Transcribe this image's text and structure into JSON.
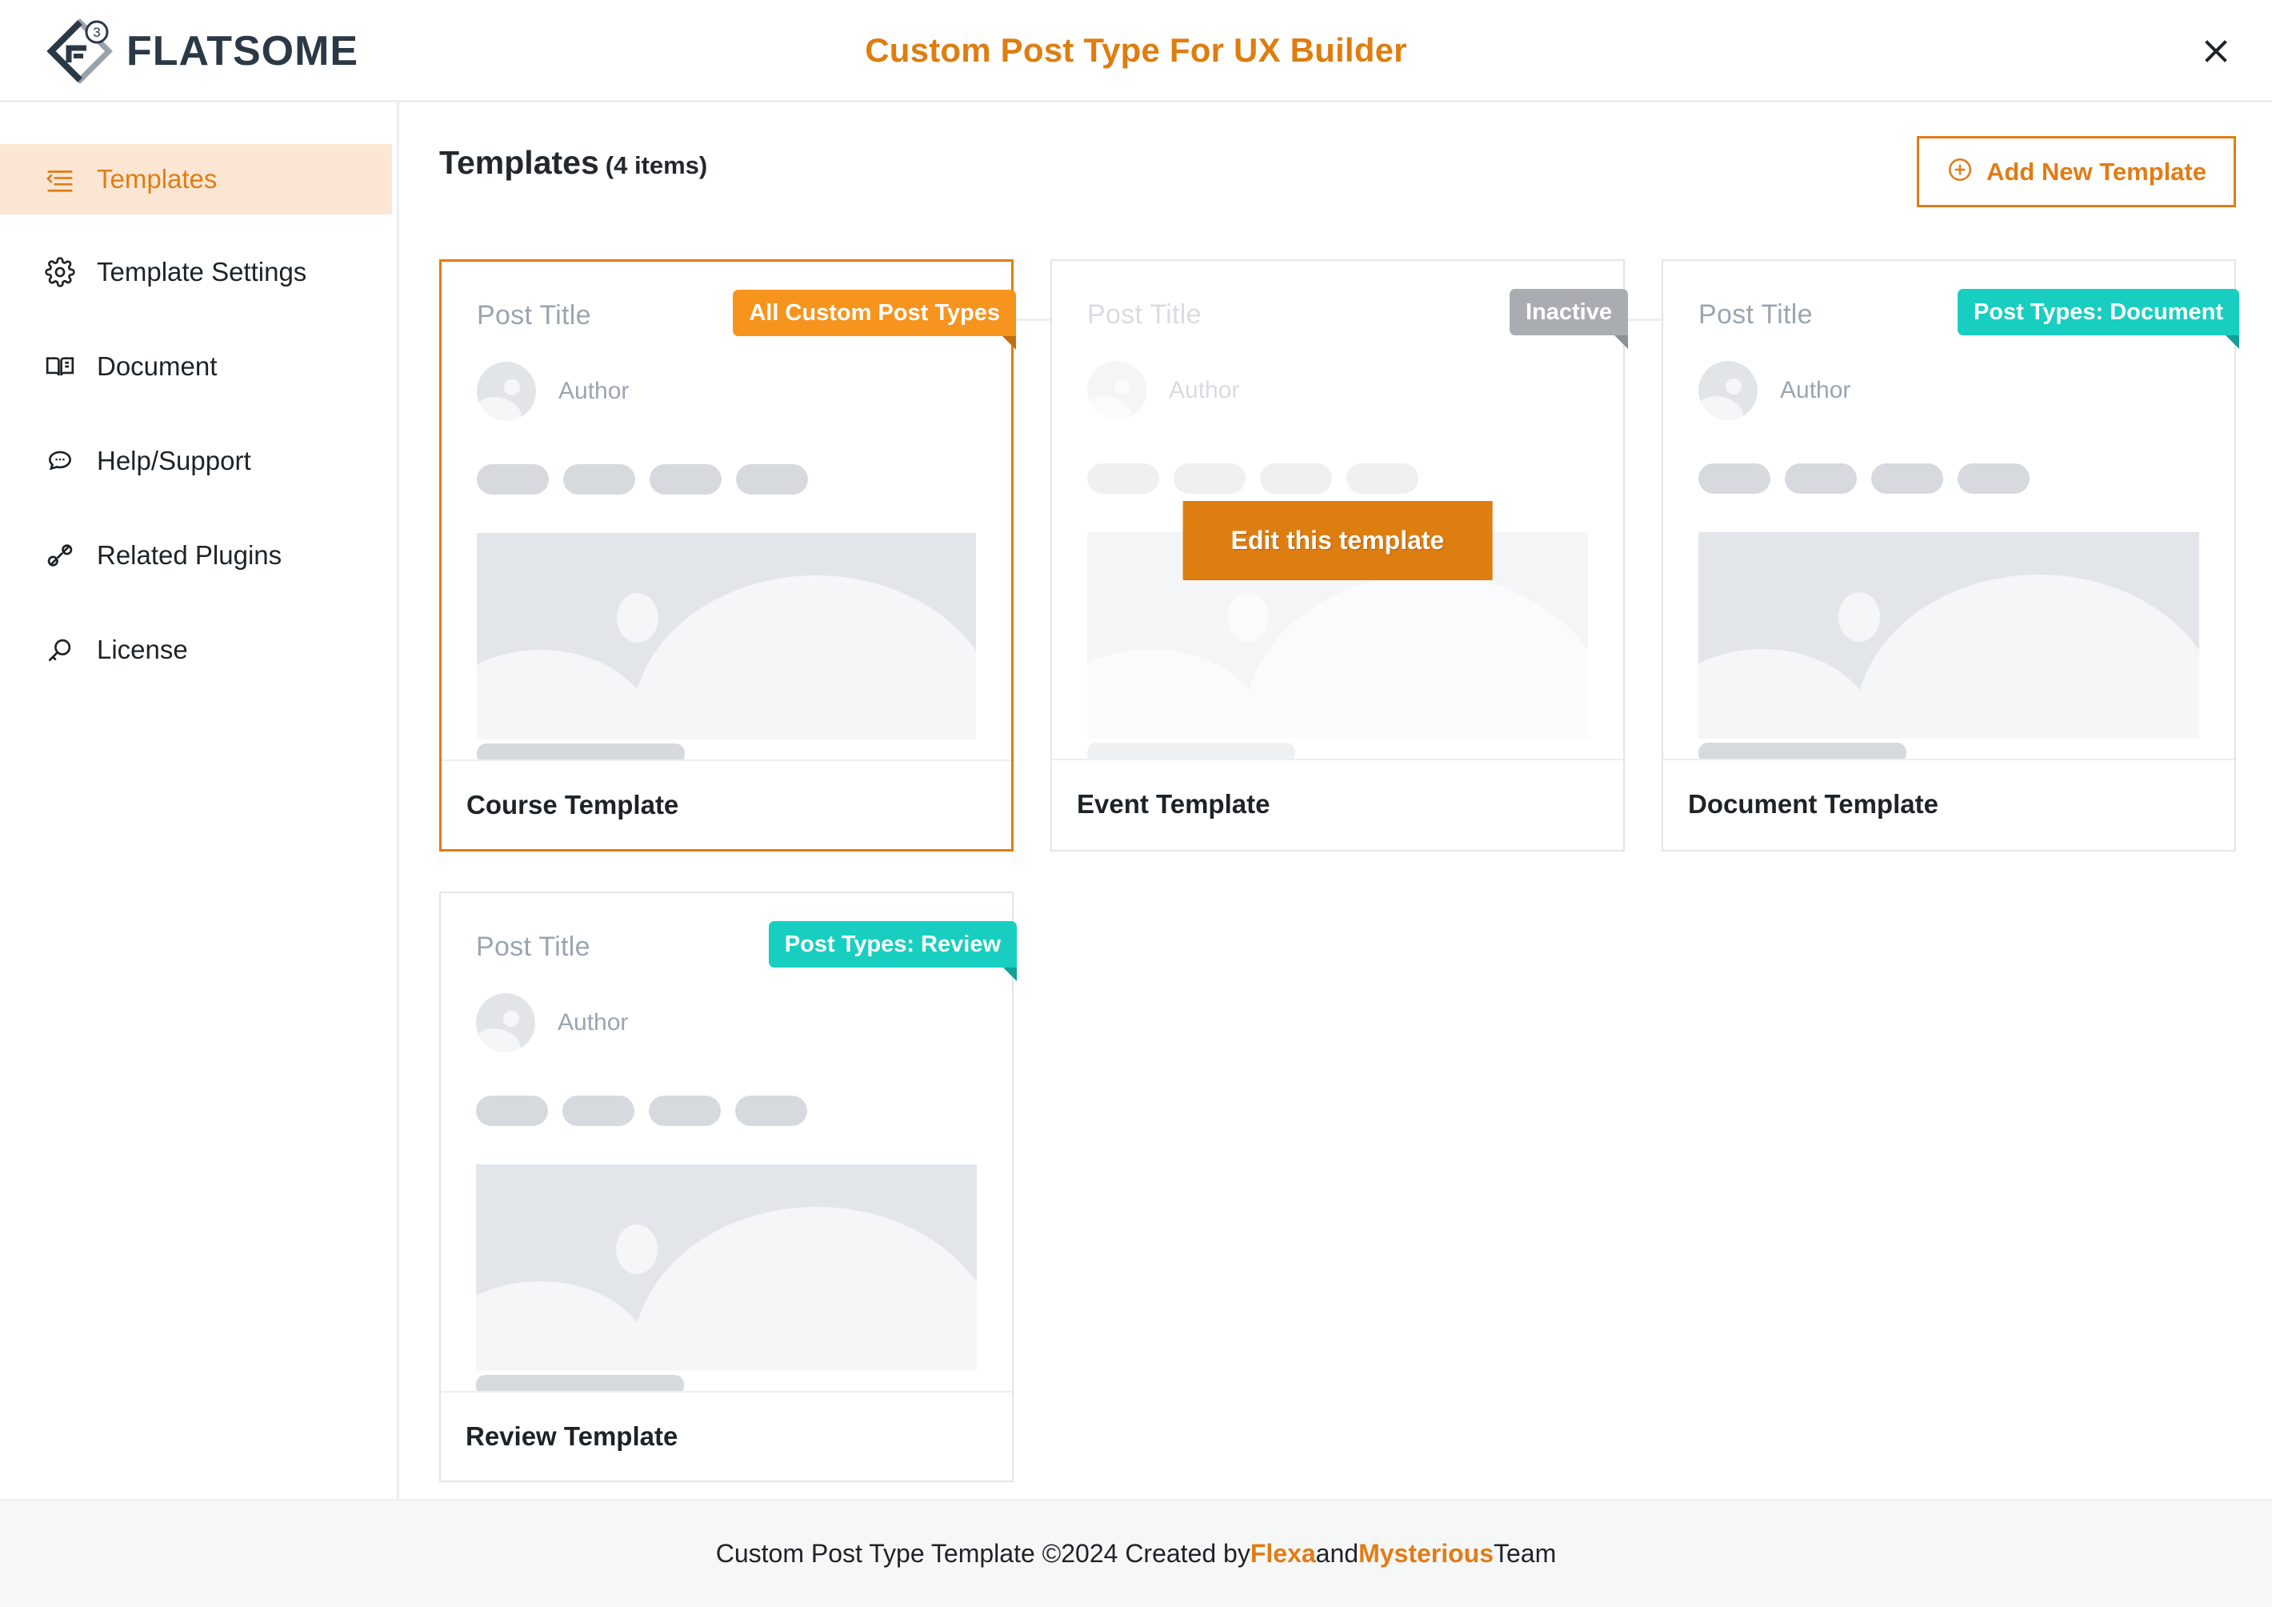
{
  "header": {
    "logo_text": "FLATSOME",
    "logo_badge": "3",
    "title": "Custom Post Type For UX Builder",
    "close_label": "✕"
  },
  "sidebar": {
    "items": [
      {
        "label": "Templates",
        "icon": "list-indent-icon",
        "active": true
      },
      {
        "label": "Template Settings",
        "icon": "gear-icon",
        "active": false
      },
      {
        "label": "Document",
        "icon": "book-icon",
        "active": false
      },
      {
        "label": "Help/Support",
        "icon": "chat-bubble-icon",
        "active": false
      },
      {
        "label": "Related Plugins",
        "icon": "plug-icon",
        "active": false
      },
      {
        "label": "License",
        "icon": "key-search-icon",
        "active": false
      }
    ]
  },
  "main": {
    "page_title": "Templates",
    "item_count": "(4 items)",
    "add_button": "Add New Template",
    "add_icon": "plus-circle-icon",
    "hover_action": "Edit this template",
    "preview": {
      "post_title": "Post Title",
      "author": "Author"
    },
    "cards": [
      {
        "name": "Course Template",
        "badge": "All Custom Post Types",
        "badge_color": "orange",
        "selected": true,
        "dim": false,
        "show_edit": false
      },
      {
        "name": "Event Template",
        "badge": "Inactive",
        "badge_color": "gray",
        "selected": false,
        "dim": true,
        "show_edit": true
      },
      {
        "name": "Document Template",
        "badge": "Post Types: Document",
        "badge_color": "teal",
        "selected": false,
        "dim": false,
        "show_edit": false
      },
      {
        "name": "Review Template",
        "badge": "Post Types: Review",
        "badge_color": "teal",
        "selected": false,
        "dim": false,
        "show_edit": false
      }
    ]
  },
  "footer": {
    "text_before": "Custom Post Type Template ©2024 Created by ",
    "link1": "Flexa",
    "text_middle": " and ",
    "link2": "Mysterious",
    "text_after": " Team"
  },
  "colors": {
    "brand_orange": "#e07c16",
    "badge_orange": "#f7941e",
    "badge_teal": "#18cec0",
    "badge_gray": "#a9adb2",
    "logo_navy": "#2b3947",
    "active_bg": "#fae6d3"
  }
}
